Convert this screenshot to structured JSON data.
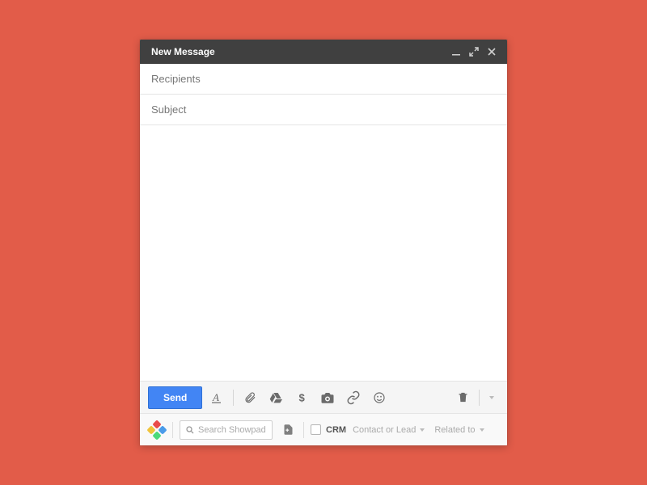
{
  "compose": {
    "title": "New Message",
    "recipients_placeholder": "Recipients",
    "recipients_value": "",
    "subject_placeholder": "Subject",
    "subject_value": "",
    "body_value": ""
  },
  "toolbar": {
    "send_label": "Send"
  },
  "integration": {
    "search_placeholder": "Search Showpad",
    "crm_label": "CRM",
    "contact_dd": "Contact or Lead",
    "related_dd": "Related to"
  }
}
